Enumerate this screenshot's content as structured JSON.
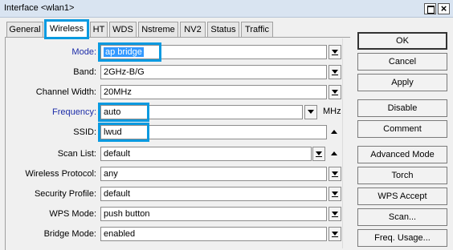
{
  "window": {
    "title": "Interface <wlan1>"
  },
  "tabs": [
    {
      "label": "General"
    },
    {
      "label": "Wireless"
    },
    {
      "label": "HT"
    },
    {
      "label": "WDS"
    },
    {
      "label": "Nstreme"
    },
    {
      "label": "NV2"
    },
    {
      "label": "Status"
    },
    {
      "label": "Traffic"
    }
  ],
  "form": {
    "mode": {
      "label": "Mode:",
      "value": "ap bridge"
    },
    "band": {
      "label": "Band:",
      "value": "2GHz-B/G"
    },
    "channel_width": {
      "label": "Channel Width:",
      "value": "20MHz"
    },
    "frequency": {
      "label": "Frequency:",
      "value": "auto",
      "unit": "MHz"
    },
    "ssid": {
      "label": "SSID:",
      "value": "lwud"
    },
    "scan_list": {
      "label": "Scan List:",
      "value": "default"
    },
    "wireless_protocol": {
      "label": "Wireless Protocol:",
      "value": "any"
    },
    "security_profile": {
      "label": "Security Profile:",
      "value": "default"
    },
    "wps_mode": {
      "label": "WPS Mode:",
      "value": "push button"
    },
    "bridge_mode": {
      "label": "Bridge Mode:",
      "value": "enabled"
    }
  },
  "buttons": {
    "ok": "OK",
    "cancel": "Cancel",
    "apply": "Apply",
    "disable": "Disable",
    "comment": "Comment",
    "advanced_mode": "Advanced Mode",
    "torch": "Torch",
    "wps_accept": "WPS Accept",
    "scan": "Scan...",
    "freq_usage": "Freq. Usage..."
  },
  "colors": {
    "highlight": "#0a9ae0",
    "selection": "#3399ff",
    "label_blue": "#1c2ca8"
  }
}
